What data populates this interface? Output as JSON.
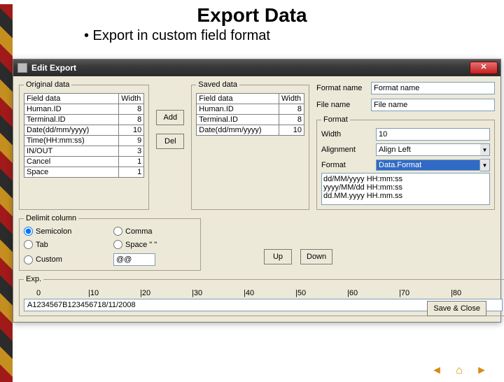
{
  "slide": {
    "title": "Export Data",
    "bullet": "• Export in custom field format"
  },
  "window": {
    "title": "Edit Export",
    "close": "✕"
  },
  "original": {
    "legend": "Original data",
    "header_field": "Field data",
    "header_width": "Width",
    "rows": [
      {
        "field": "Human.ID",
        "width": "8"
      },
      {
        "field": "Terminal.ID",
        "width": "8"
      },
      {
        "field": "Date(dd/mm/yyyy)",
        "width": "10"
      },
      {
        "field": "Time(HH:mm:ss)",
        "width": "9"
      },
      {
        "field": "IN/OUT",
        "width": "3"
      },
      {
        "field": "Cancel",
        "width": "1"
      },
      {
        "field": "Space",
        "width": "1"
      }
    ]
  },
  "mid": {
    "add": "Add",
    "del": "Del"
  },
  "saved": {
    "legend": "Saved data",
    "header_field": "Field data",
    "header_width": "Width",
    "rows": [
      {
        "field": "Human.ID",
        "width": "8"
      },
      {
        "field": "Terminal.ID",
        "width": "8"
      },
      {
        "field": "Date(dd/mm/yyyy)",
        "width": "10"
      }
    ]
  },
  "right": {
    "format_name_label": "Format name",
    "format_name_value": "Format name",
    "file_name_label": "File name",
    "file_name_value": "File name"
  },
  "format": {
    "legend": "Format",
    "width_label": "Width",
    "width_value": "10",
    "align_label": "Alignment",
    "align_value": "Align Left",
    "format_label": "Format",
    "format_value": "Data.Format",
    "options": [
      "dd/MM/yyyy HH:mm:ss",
      "yyyy/MM/dd HH:mm:ss",
      "dd.MM.yyyy HH.mm.ss"
    ]
  },
  "delimit": {
    "legend": "Delimit column",
    "semicolon": "Semicolon",
    "comma": "Comma",
    "tab": "Tab",
    "space": "Space \" \"",
    "custom": "Custom",
    "custom_value": "@@"
  },
  "updown": {
    "up": "Up",
    "down": "Down"
  },
  "exp": {
    "legend": "Exp.",
    "ruler": [
      "0",
      "|10",
      "|20",
      "|30",
      "|40",
      "|50",
      "|60",
      "|70",
      "|80"
    ],
    "sample": "A1234567B123456718/11/2008"
  },
  "footer": {
    "save_close": "Save & Close"
  }
}
